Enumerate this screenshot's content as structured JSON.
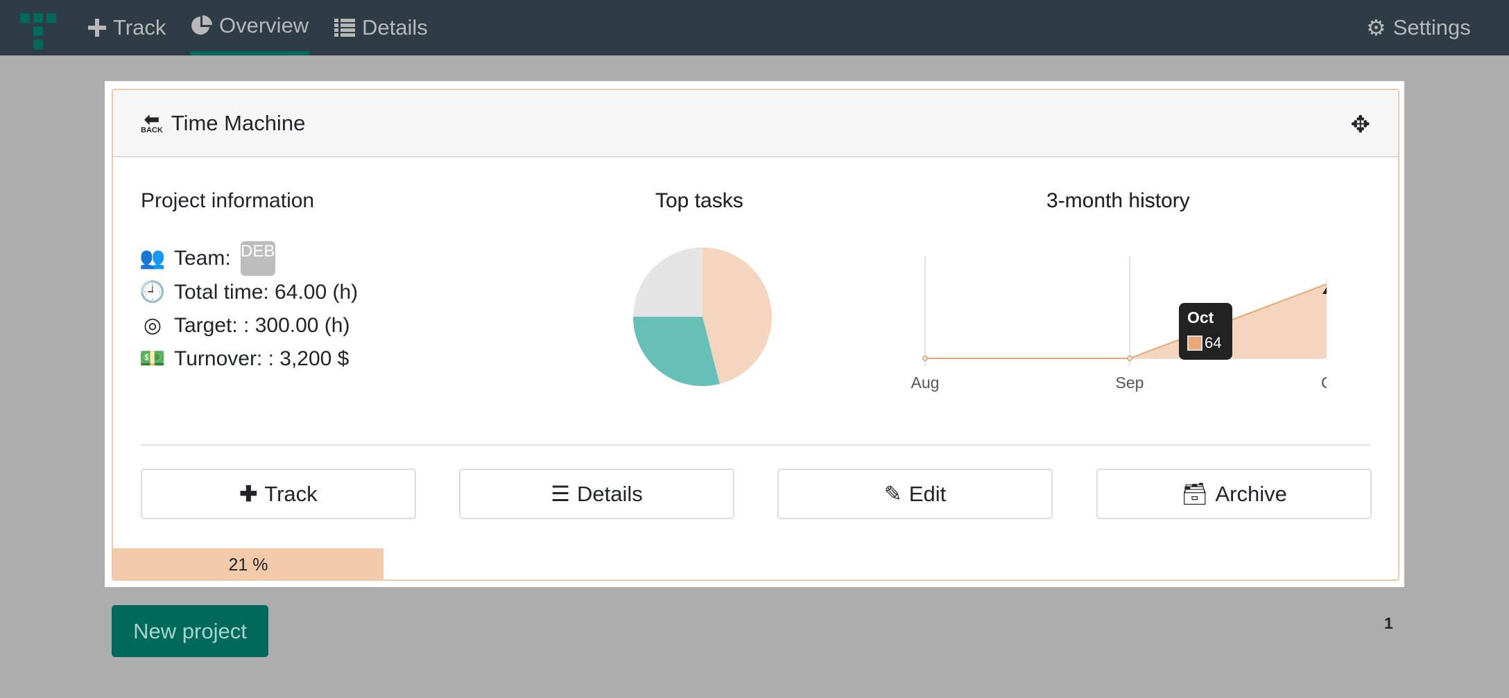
{
  "nav": {
    "items": [
      {
        "label": "Track",
        "icon": "plus-icon"
      },
      {
        "label": "Overview",
        "icon": "pie-chart-icon",
        "active": true
      },
      {
        "label": "Details",
        "icon": "list-icon"
      }
    ],
    "settings": "Settings"
  },
  "card": {
    "title": "Time Machine",
    "back_icon": "back-icon",
    "move_icon": "move-icon"
  },
  "info": {
    "heading": "Project information",
    "team_label": "Team:",
    "team_avatar": "DEB",
    "total_time": "Total time: 64.00 (h)",
    "target": "Target: : 300.00 (h)",
    "turnover": "Turnover: : 3,200 $"
  },
  "top_tasks": {
    "heading": "Top tasks"
  },
  "history": {
    "heading": "3-month history"
  },
  "chart_data": [
    {
      "type": "pie",
      "title": "Top tasks",
      "slices": [
        {
          "value": 46,
          "color": "#f5d5bd"
        },
        {
          "value": 29,
          "color": "#66c0b7"
        },
        {
          "value": 25,
          "color": "#e5e5e5"
        }
      ]
    },
    {
      "type": "area",
      "title": "3-month history",
      "categories": [
        "Aug",
        "Sep",
        "Oct"
      ],
      "values": [
        0,
        0,
        64
      ],
      "color": "#e8a877",
      "fill": "#f5d5bd",
      "grid": "vertical",
      "tooltip": {
        "label": "Oct",
        "value": "64"
      }
    }
  ],
  "buttons": {
    "track": "Track",
    "details": "Details",
    "edit": "Edit",
    "archive": "Archive"
  },
  "progress": {
    "label": "21 %",
    "value": 21
  },
  "new_project": "New project",
  "pagination": {
    "current": "1"
  },
  "colors": {
    "nav": "#2e3c45",
    "accent": "#00695c",
    "peach": "#f2c9a9"
  }
}
